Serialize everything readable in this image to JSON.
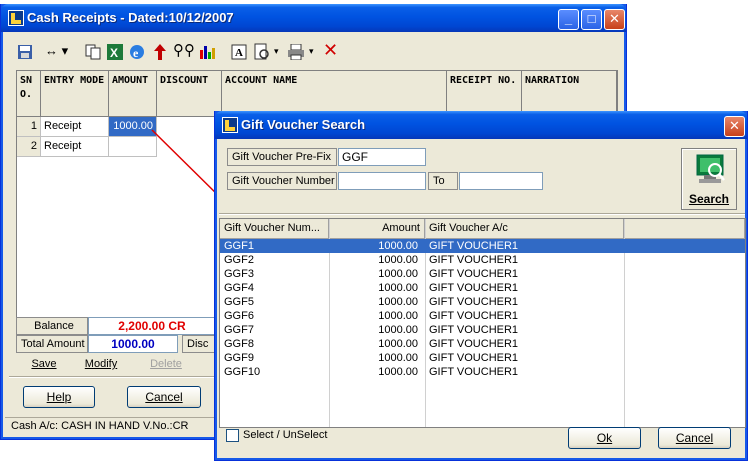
{
  "cash_receipts": {
    "title": "Cash Receipts - Dated:10/12/2007",
    "grid": {
      "headers": [
        "SN O.",
        "ENTRY MODE",
        "AMOUNT",
        "DISCOUNT",
        "ACCOUNT NAME",
        "RECEIPT NO.",
        "NARRATION"
      ],
      "rows": [
        {
          "sno": "1",
          "mode": "Receipt",
          "amount": "1000.00"
        },
        {
          "sno": "2",
          "mode": "Receipt",
          "amount": ""
        }
      ]
    },
    "balance_label": "Balance",
    "balance_value": "2,200.00 CR",
    "total_label": "Total Amount",
    "total_value": "1000.00",
    "discount_label": "Disc",
    "actions": {
      "save": "Save",
      "modify": "Modify",
      "delete": "Delete"
    },
    "help_label": "Help",
    "cancel_label": "Cancel",
    "status_text": "Cash A/c: CASH IN HAND V.No.:CR"
  },
  "gift_voucher_search": {
    "title": "Gift Voucher Search",
    "prefix_label": "Gift Voucher Pre-Fix",
    "prefix_value": "GGF",
    "number_label": "Gift Voucher Number",
    "number_from": "",
    "to_label": "To",
    "number_to": "",
    "search_label": "Search",
    "columns": [
      "Gift Voucher Num...",
      "Amount",
      "Gift Voucher A/c"
    ],
    "rows": [
      {
        "num": "GGF1",
        "amount": "1000.00",
        "account": "GIFT VOUCHER1"
      },
      {
        "num": "GGF2",
        "amount": "1000.00",
        "account": "GIFT VOUCHER1"
      },
      {
        "num": "GGF3",
        "amount": "1000.00",
        "account": "GIFT VOUCHER1"
      },
      {
        "num": "GGF4",
        "amount": "1000.00",
        "account": "GIFT VOUCHER1"
      },
      {
        "num": "GGF5",
        "amount": "1000.00",
        "account": "GIFT VOUCHER1"
      },
      {
        "num": "GGF6",
        "amount": "1000.00",
        "account": "GIFT VOUCHER1"
      },
      {
        "num": "GGF7",
        "amount": "1000.00",
        "account": "GIFT VOUCHER1"
      },
      {
        "num": "GGF8",
        "amount": "1000.00",
        "account": "GIFT VOUCHER1"
      },
      {
        "num": "GGF9",
        "amount": "1000.00",
        "account": "GIFT VOUCHER1"
      },
      {
        "num": "GGF10",
        "amount": "1000.00",
        "account": "GIFT VOUCHER1"
      }
    ],
    "select_label": "Select / UnSelect",
    "ok_label": "Ok",
    "cancel_label": "Cancel"
  },
  "colors": {
    "title_blue": "#0053e1",
    "balance_red": "#e00000",
    "total_blue": "#0000c0",
    "selection": "#316ac5",
    "arrow_red": "#e00000"
  },
  "icons": [
    "app-icon",
    "minimize-icon",
    "maximize-icon",
    "close-icon",
    "save-icon",
    "resize-icon",
    "copy-icon",
    "excel-icon",
    "ie-icon",
    "up-arrow-icon",
    "binoculars-icon",
    "chart-icon",
    "text-icon",
    "print-preview-icon",
    "print-icon",
    "delete-icon",
    "search-computer-icon"
  ]
}
